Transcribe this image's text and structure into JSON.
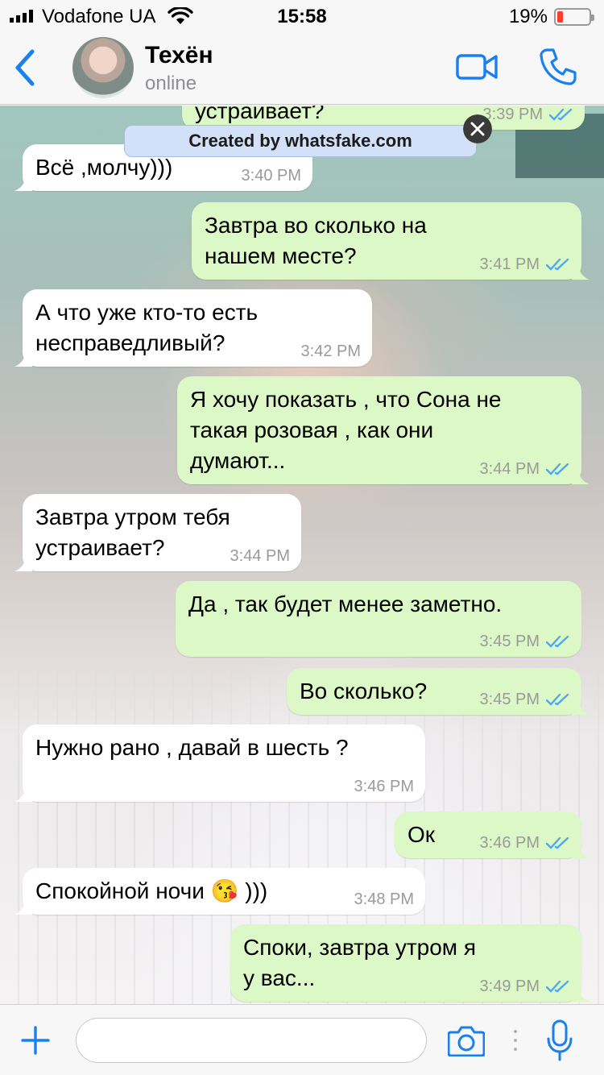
{
  "status_bar": {
    "carrier": "Vodafone UA",
    "time": "15:58",
    "battery_percent_label": "19%",
    "battery_level": 0.19
  },
  "header": {
    "contact_name": "Техён",
    "contact_status": "online",
    "icons": [
      "chevron-left-icon",
      "video-camera-icon",
      "phone-icon"
    ]
  },
  "watermark": {
    "label": "Created by whatsfake.com"
  },
  "messages": [
    {
      "direction": "out",
      "text": "устраивает?",
      "time": "3:39 PM",
      "read": true
    },
    {
      "direction": "in",
      "text": "Всё ,молчу)))",
      "time": "3:40 PM"
    },
    {
      "direction": "out",
      "text": "Завтра во сколько на\nнашем месте?",
      "time": "3:41 PM",
      "read": true
    },
    {
      "direction": "in",
      "text": "А что уже кто-то есть\nнесправедливый?",
      "time": "3:42 PM"
    },
    {
      "direction": "out",
      "text": "Я хочу показать , что Сона не\nтакая розовая , как они\nдумают...",
      "time": "3:44 PM",
      "read": true
    },
    {
      "direction": "in",
      "text": "Завтра утром тебя\nустраивает?",
      "time": "3:44 PM"
    },
    {
      "direction": "out",
      "text": "Да , так будет менее заметно.",
      "time": "3:45 PM",
      "read": true
    },
    {
      "direction": "out",
      "text": "Во сколько?",
      "time": "3:45 PM",
      "read": true
    },
    {
      "direction": "in",
      "text": "Нужно рано , давай в шесть ?",
      "time": "3:46 PM"
    },
    {
      "direction": "out",
      "text": "Ок",
      "time": "3:46 PM",
      "read": true
    },
    {
      "direction": "in",
      "text": "Спокойной ночи 😘 )))",
      "time": "3:48 PM"
    },
    {
      "direction": "out",
      "text": "Споки, завтра утром я\nу вас...",
      "time": "3:49 PM",
      "read": true
    }
  ],
  "input_bar": {
    "placeholder": "",
    "value": "",
    "icons": [
      "plus-icon",
      "camera-icon",
      "microphone-icon"
    ]
  },
  "colors": {
    "accent": "#1a7ff0",
    "incoming_bubble": "#ffffff",
    "outgoing_bubble": "#dcf8c6",
    "read_ticks": "#4fa8f0",
    "battery_low": "#ff3b30"
  }
}
